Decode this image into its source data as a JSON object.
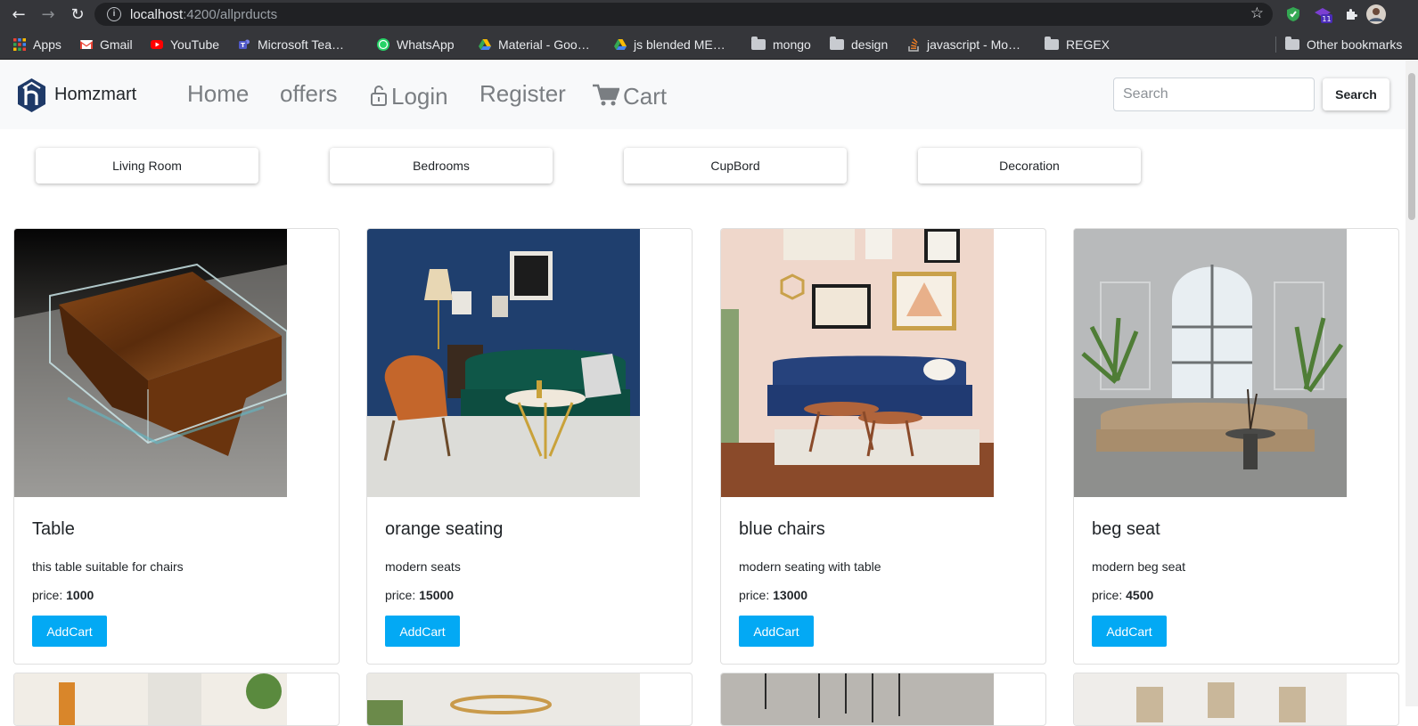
{
  "browser": {
    "url_host": "localhost",
    "url_rest": ":4200/allprducts",
    "extension_badge": "11",
    "bookmarks": [
      {
        "label": "Apps",
        "icon": "apps-grid-icon"
      },
      {
        "label": "Gmail",
        "icon": "gmail-icon"
      },
      {
        "label": "YouTube",
        "icon": "youtube-icon"
      },
      {
        "label": "Microsoft Tea…",
        "icon": "teams-icon"
      },
      {
        "label": "WhatsApp",
        "icon": "whatsapp-icon"
      },
      {
        "label": "Material - Goo…",
        "icon": "drive-icon"
      },
      {
        "label": "js blended ME…",
        "icon": "drive-icon"
      },
      {
        "label": "mongo",
        "icon": "folder-icon"
      },
      {
        "label": "design",
        "icon": "folder-icon"
      },
      {
        "label": "javascript - Mo…",
        "icon": "stackoverflow-icon"
      },
      {
        "label": "REGEX",
        "icon": "folder-icon"
      }
    ],
    "other_bookmarks": "Other bookmarks"
  },
  "navbar": {
    "brand": "Homzmart",
    "links": {
      "home": "Home",
      "offers": "offers",
      "login": "Login",
      "register": "Register",
      "cart": "Cart"
    },
    "search_placeholder": "Search",
    "search_button": "Search"
  },
  "categories": [
    "Living Room",
    "Bedrooms",
    "CupBord",
    "Decoration"
  ],
  "products": [
    {
      "title": "Table",
      "description": "this table suitable for chairs",
      "price_label": "price:",
      "price": "1000",
      "button": "AddCart"
    },
    {
      "title": "orange seating",
      "description": "modern seats",
      "price_label": "price:",
      "price": "15000",
      "button": "AddCart"
    },
    {
      "title": "blue chairs",
      "description": "modern seating with table",
      "price_label": "price:",
      "price": "13000",
      "button": "AddCart"
    },
    {
      "title": "beg seat",
      "description": "modern beg seat",
      "price_label": "price:",
      "price": "4500",
      "button": "AddCart"
    }
  ],
  "colors": {
    "primary_button": "#03a9f4",
    "navbar_bg": "#f8f9fa",
    "browser_chrome": "#35363a"
  }
}
